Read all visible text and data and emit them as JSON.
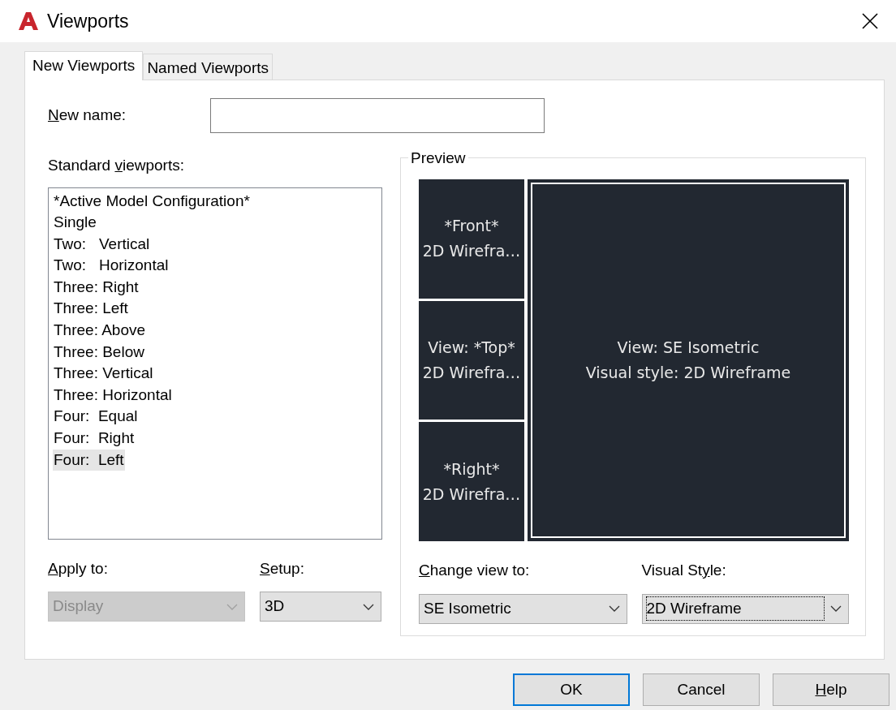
{
  "window": {
    "title": "Viewports"
  },
  "tabs": [
    {
      "label": "New Viewports",
      "selected": true
    },
    {
      "label": "Named Viewports",
      "selected": false
    }
  ],
  "new_name": {
    "label": {
      "key": "N",
      "after": "ew name:"
    }
  },
  "standard_viewports": {
    "label": {
      "before": "Standard ",
      "key": "v",
      "after": "iewports:"
    },
    "items": [
      {
        "text": "*Active Model Configuration*",
        "selected": false
      },
      {
        "text": "Single",
        "selected": false
      },
      {
        "text": "Two:   Vertical",
        "selected": false
      },
      {
        "text": "Two:   Horizontal",
        "selected": false
      },
      {
        "text": "Three: Right",
        "selected": false
      },
      {
        "text": "Three: Left",
        "selected": false
      },
      {
        "text": "Three: Above",
        "selected": false
      },
      {
        "text": "Three: Below",
        "selected": false
      },
      {
        "text": "Three: Vertical",
        "selected": false
      },
      {
        "text": "Three: Horizontal",
        "selected": false
      },
      {
        "text": "Four:  Equal",
        "selected": false
      },
      {
        "text": "Four:  Right",
        "selected": false
      },
      {
        "text": "Four:  Left",
        "selected": true
      }
    ]
  },
  "preview": {
    "title": "Preview",
    "side_viewports": [
      {
        "lines": [
          "*Front*",
          "2D Wirefra…"
        ],
        "active": false
      },
      {
        "lines": [
          "View: *Top*",
          "2D Wirefra…"
        ],
        "active": false
      },
      {
        "lines": [
          "*Right*",
          "2D Wirefra…"
        ],
        "active": false
      }
    ],
    "main_viewport": {
      "lines": [
        "View: SE Isometric",
        "Visual style: 2D Wireframe"
      ],
      "active": true
    }
  },
  "left_dropdowns": [
    {
      "label": {
        "key": "A",
        "after": "pply to:"
      },
      "value": "Display",
      "disabled": true,
      "focused": false
    },
    {
      "label": {
        "key": "S",
        "after": "etup:"
      },
      "value": "3D",
      "disabled": false,
      "focused": false
    }
  ],
  "preview_dropdowns": [
    {
      "label": {
        "key": "C",
        "after": "hange view to:"
      },
      "value": "SE Isometric",
      "disabled": false,
      "focused": false
    },
    {
      "label": {
        "before": "Visual St",
        "key": "y",
        "after": "le:"
      },
      "value": "2D Wireframe",
      "disabled": false,
      "focused": true
    }
  ],
  "buttons": [
    {
      "label": {
        "before": "OK"
      },
      "default": true
    },
    {
      "label": {
        "before": "Cancel"
      },
      "default": false
    },
    {
      "label": {
        "key": "H",
        "after": "elp"
      },
      "default": false
    }
  ]
}
